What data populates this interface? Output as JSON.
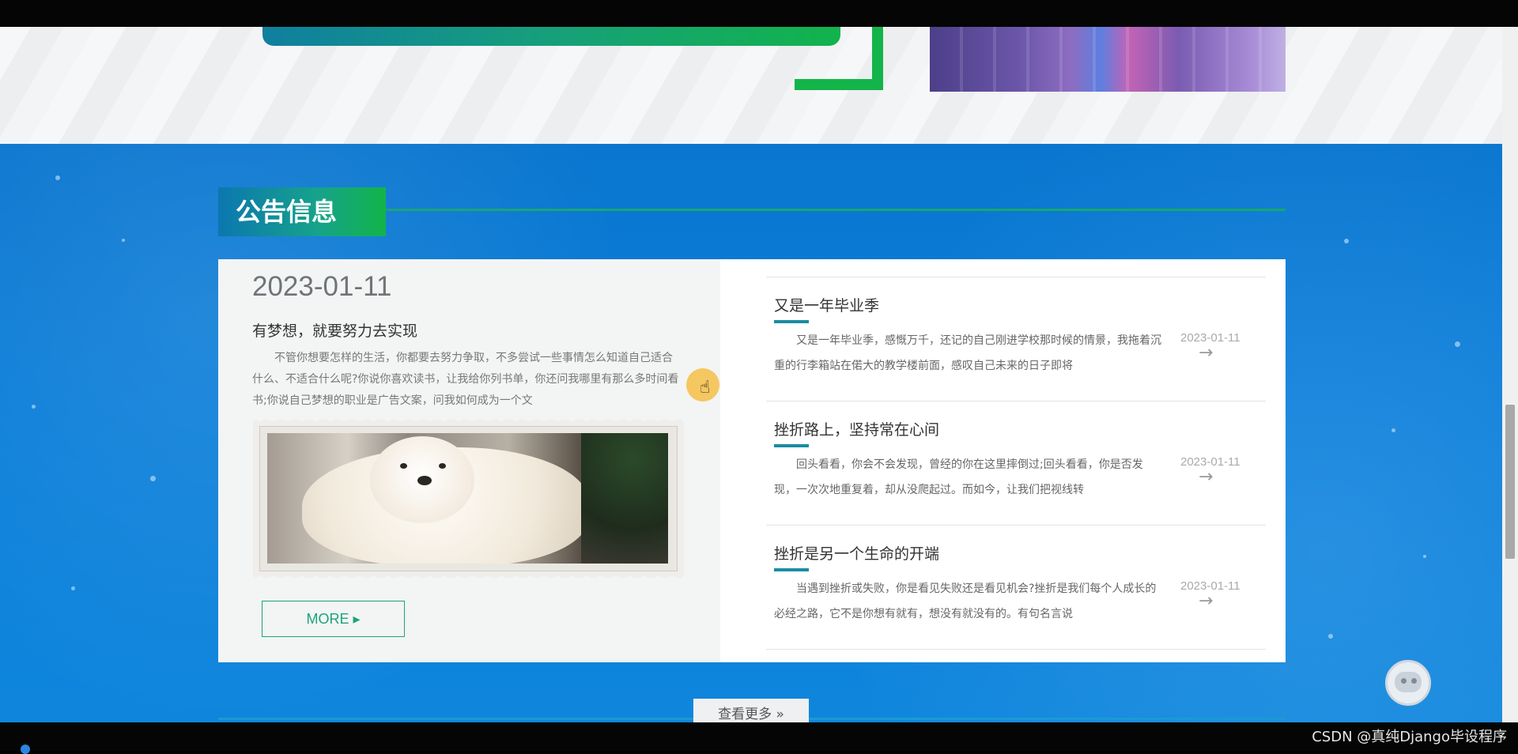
{
  "section": {
    "title": "公告信息"
  },
  "featured": {
    "date": "2023-01-11",
    "title": "有梦想，就要努力去实现",
    "excerpt": "不管你想要怎样的生活，你都要去努力争取，不多尝试一些事情怎么知道自己适合什么、不适合什么呢?你说你喜欢读书，让我给你列书单，你还问我哪里有那么多时间看书;你说自己梦想的职业是广告文案，问我如何成为一个文",
    "more_label": "MORE ▸"
  },
  "news": [
    {
      "title": "又是一年毕业季",
      "excerpt": "又是一年毕业季，感慨万千，还记的自己刚进学校那时候的情景，我拖着沉重的行李箱站在偌大的教学楼前面，感叹自己未来的日子即将",
      "date": "2023-01-11"
    },
    {
      "title": "挫折路上，坚持常在心间",
      "excerpt": "回头看看，你会不会发现，曾经的你在这里摔倒过;回头看看，你是否发现，一次次地重复着，却从没爬起过。而如今，让我们把视线转",
      "date": "2023-01-11"
    },
    {
      "title": "挫折是另一个生命的开端",
      "excerpt": "当遇到挫折或失败，你是看见失败还是看见机会?挫折是我们每个人成长的必经之路，它不是你想有就有，想没有就没有的。有句名言说",
      "date": "2023-01-11"
    }
  ],
  "view_more": "查看更多 »",
  "watermark": "CSDN @真纯Django毕设程序",
  "icons": {
    "arrow": "→"
  }
}
